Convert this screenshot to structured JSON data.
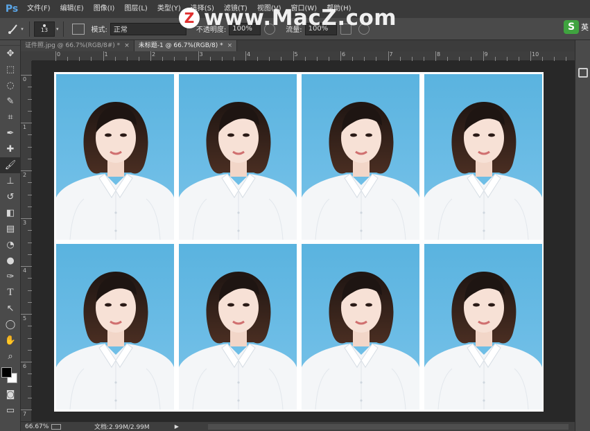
{
  "app": {
    "logo": "Ps"
  },
  "menu": [
    "文件(F)",
    "编辑(E)",
    "图像(I)",
    "图层(L)",
    "类型(Y)",
    "选择(S)",
    "滤镜(T)",
    "视图(V)",
    "窗口(W)",
    "帮助(H)"
  ],
  "watermark": {
    "logo_letter": "Z",
    "text": "www.MacZ.com"
  },
  "options": {
    "brush_size": "13",
    "mode_label": "模式:",
    "mode_value": "正常",
    "opacity_label": "不透明度:",
    "opacity_value": "100%",
    "flow_label": "流量:",
    "flow_value": "100%"
  },
  "ime": {
    "logo": "S",
    "label": "英"
  },
  "tabs": [
    {
      "label": "证件照.jpg @ 66.7%(RGB/8#) *",
      "active": false
    },
    {
      "label": "未标题-1 @ 66.7%(RGB/8) *",
      "active": true
    }
  ],
  "ruler_h": [
    "0",
    "1",
    "2",
    "3",
    "4",
    "5",
    "6",
    "7",
    "8",
    "9",
    "10"
  ],
  "ruler_v": [
    "0",
    "1",
    "2",
    "3",
    "4",
    "5",
    "6",
    "7"
  ],
  "status": {
    "zoom": "66.67%",
    "doc": "文档:2.99M/2.99M"
  },
  "colors": {
    "foreground": "#000000",
    "background": "#ffffff",
    "photo_bg": "#5ab3df"
  },
  "tools": [
    "move-tool",
    "marquee-tool",
    "lasso-tool",
    "quick-select-tool",
    "crop-tool",
    "eyedropper-tool",
    "spot-heal-tool",
    "brush-tool",
    "clone-stamp-tool",
    "history-brush-tool",
    "eraser-tool",
    "gradient-tool",
    "blur-tool",
    "dodge-tool",
    "pen-tool",
    "type-tool",
    "path-select-tool",
    "shape-tool",
    "hand-tool",
    "zoom-tool"
  ],
  "photo_count": 8
}
